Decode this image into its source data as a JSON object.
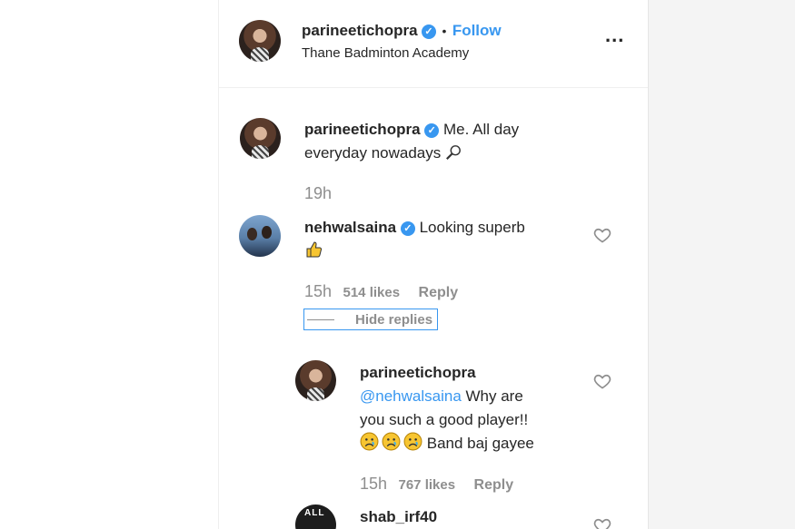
{
  "header": {
    "username": "parineetichopra",
    "separator": "•",
    "follow_label": "Follow",
    "location": "Thane Badminton Academy",
    "more_label": "..."
  },
  "caption": {
    "username": "parineetichopra",
    "text_line1": "Me. All day",
    "text_line2": "everyday nowadays",
    "time": "19h"
  },
  "comments": [
    {
      "username": "nehwalsaina",
      "text": "Looking superb",
      "time": "15h",
      "likes": "514 likes",
      "reply_label": "Reply",
      "hide_replies_label": "Hide replies"
    }
  ],
  "replies": [
    {
      "username": "parineetichopra",
      "mention": "@nehwalsaina",
      "text_line1": " Why are",
      "text_line2": "you such a good player!!",
      "text_line3": "Band baj gayee",
      "time": "15h",
      "likes": "767 likes",
      "reply_label": "Reply"
    },
    {
      "username": "shab_irf40",
      "avatar_text": "ALL"
    }
  ],
  "icons": {
    "verified": "verified-badge-icon",
    "heart": "heart-icon",
    "racket": "badminton-racket-emoji",
    "thumbs": "thumbs-up-emoji",
    "sad": "sad-face-emoji"
  },
  "colors": {
    "link": "#3897f0",
    "muted": "#8e8e8e",
    "text": "#262626"
  }
}
